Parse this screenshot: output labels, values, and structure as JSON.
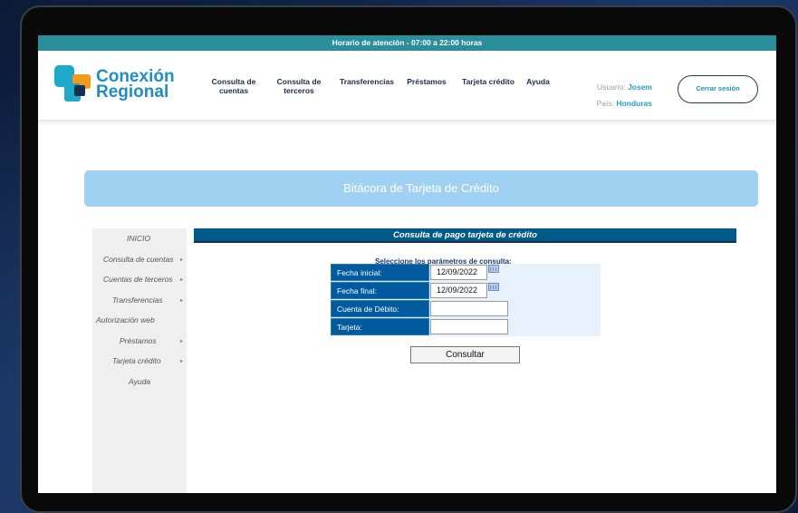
{
  "topbar": {
    "text": "Horario de atención - 07:00 a 22:00 horas"
  },
  "logo": {
    "line1": "Conexión",
    "line2": "Regional"
  },
  "nav": [
    {
      "label1": "Consulta de",
      "label2": "cuentas"
    },
    {
      "label1": "Consulta de",
      "label2": "terceros"
    },
    {
      "label1": "Transferencias",
      "label2": ""
    },
    {
      "label1": "Préstamos",
      "label2": ""
    },
    {
      "label1": "Tarjeta crédito",
      "label2": ""
    },
    {
      "label1": "Ayuda",
      "label2": ""
    }
  ],
  "user": {
    "user_label": "Usuario:",
    "user_value": "Josem",
    "country_label": "País:",
    "country_value": "Honduras"
  },
  "logout": {
    "label": "Cerrar sesión"
  },
  "banner": {
    "title": "Bitácora de Tarjeta de Crédito"
  },
  "sidebar": {
    "items": [
      {
        "label": "INICIO",
        "arrow": ""
      },
      {
        "label": "Consulta de cuentas",
        "arrow": "▸"
      },
      {
        "label": "Cuentas de terceros",
        "arrow": "▸"
      },
      {
        "label": "Transferencias",
        "arrow": "▸"
      },
      {
        "label": "Autorización web",
        "arrow": ""
      },
      {
        "label": "Préstamos",
        "arrow": "▸"
      },
      {
        "label": "Tarjeta crédito",
        "arrow": "▸"
      },
      {
        "label": "Ayuda",
        "arrow": ""
      }
    ]
  },
  "main": {
    "title": "Consulta de pago tarjeta de crédito",
    "prompt": "Seleccione los parámetros de consulta:",
    "fields": [
      {
        "label": "Fecha inicial:",
        "value": "12/09/2022"
      },
      {
        "label": "Fecha final:",
        "value": "12/09/2022"
      },
      {
        "label": "Cuenta de Débito:",
        "value": ""
      },
      {
        "label": "Tarjeta:",
        "value": ""
      }
    ],
    "submit": "Consultar"
  }
}
